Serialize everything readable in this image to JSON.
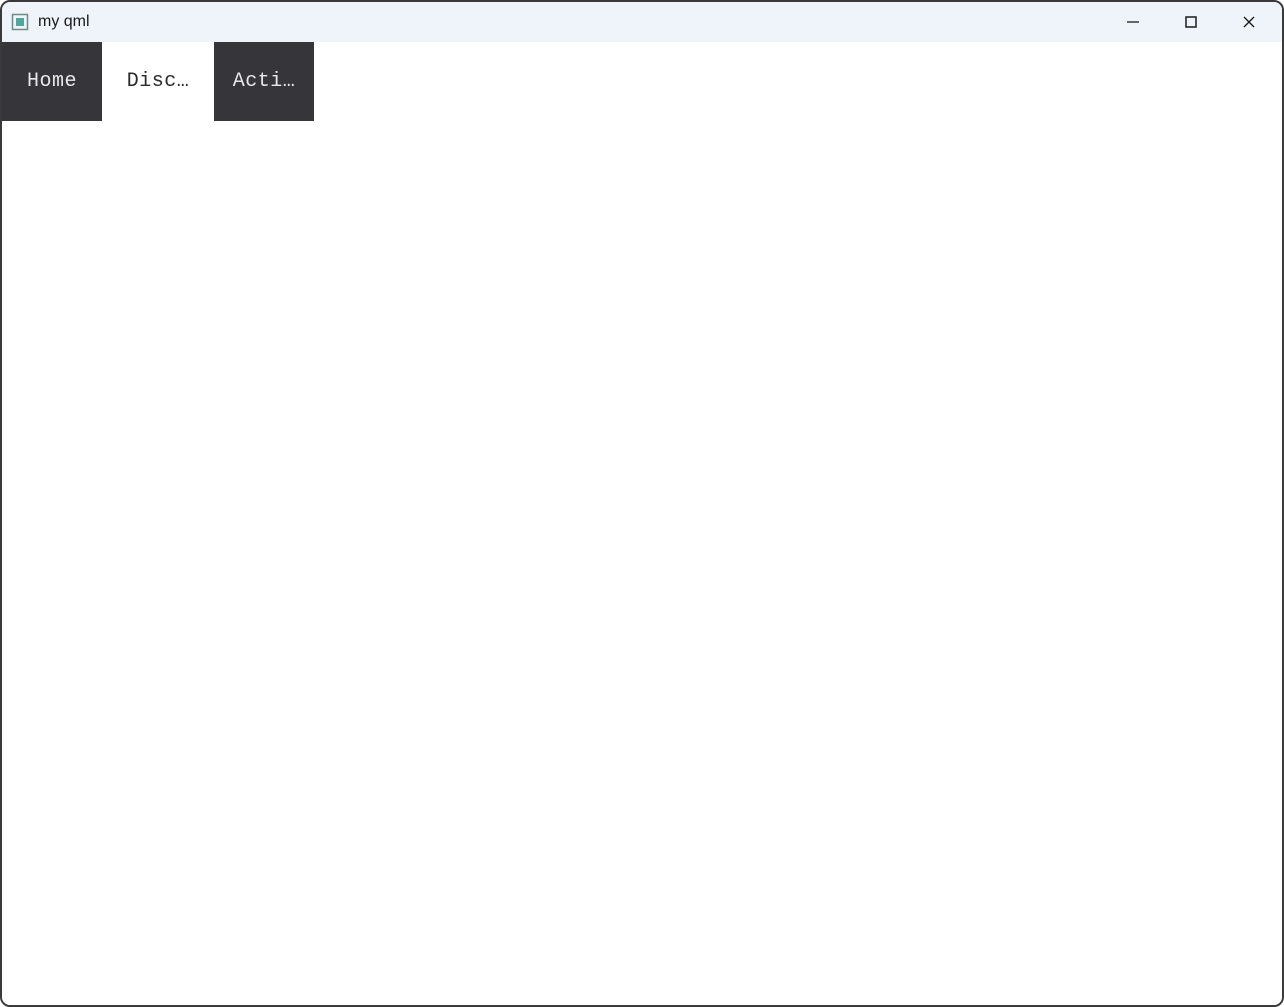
{
  "window": {
    "title": "my qml"
  },
  "tabs": [
    {
      "label": "Home",
      "selected": false
    },
    {
      "label": "Disc…",
      "selected": true
    },
    {
      "label": "Acti…",
      "selected": false
    }
  ],
  "icons": {
    "app": "app-icon",
    "minimize": "minimize-icon",
    "maximize": "maximize-icon",
    "close": "close-icon"
  }
}
